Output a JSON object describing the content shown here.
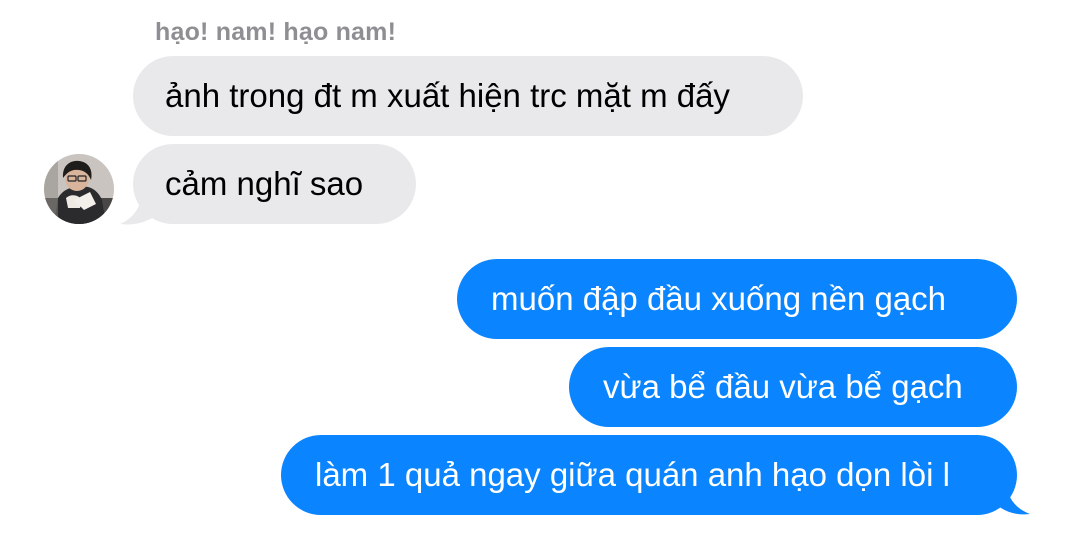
{
  "conversation": {
    "sender_name": "hạo! nam! hạo nam!",
    "incoming": [
      {
        "text": "ảnh trong đt m xuất hiện trc mặt m đấy"
      },
      {
        "text": "cảm nghĩ sao"
      }
    ],
    "outgoing": [
      {
        "text": "muốn đập đầu xuống nền gạch"
      },
      {
        "text": "vừa bể đầu vừa bể gạch"
      },
      {
        "text": "làm 1 quả ngay giữa quán anh hạo dọn lòi l"
      }
    ]
  },
  "colors": {
    "incoming_bubble": "#e9e9eb",
    "outgoing_bubble": "#0a84ff",
    "sender_name": "#8e8e93"
  },
  "icons": {
    "avatar": "profile-photo"
  }
}
